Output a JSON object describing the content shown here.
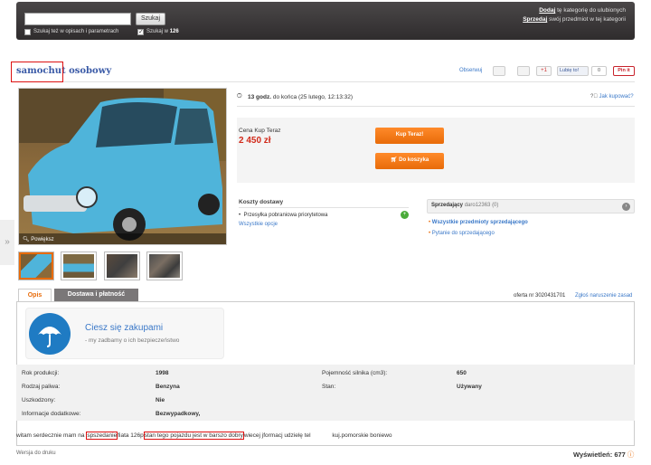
{
  "search": {
    "button_label": "Szukaj",
    "checkbox_desc_label": "Szukaj też w opisach i parametrach",
    "checkbox_cat_prefix": "Szukaj w",
    "checkbox_cat_value": "126"
  },
  "top_right": {
    "line1_link": "Dodaj",
    "line1_rest": "tę kategorię do ulubionych",
    "line2_link": "Sprzedaj",
    "line2_rest": "swój przedmiot w tej kategorii"
  },
  "title": "samochut osobowy",
  "actions": {
    "watch": "Obserwuj",
    "gplus": "+1",
    "fb_like": "Lubię to!",
    "fb_count": "0",
    "pinit": "Pin it"
  },
  "photo": {
    "zoom_label": "Powiększ"
  },
  "timer": {
    "bold": "13 godz.",
    "rest": "do końca (25 lutego, 12:13:32)"
  },
  "help_link": "Jak kupować?",
  "price": {
    "label": "Cena Kup Teraz",
    "value": "2 450 zł",
    "buy_now": "Kup Teraz!",
    "add_cart": "Do koszyka"
  },
  "shipping": {
    "title": "Koszty dostawy",
    "item": "Przesyłka pobraniowa priorytetowa",
    "all_options": "Wszystkie opcje"
  },
  "seller": {
    "label": "Sprzedający",
    "name": "daro12363 (0)",
    "all_items": "Wszystkie przedmioty sprzedającego",
    "ask": "Pytanie do sprzedającego"
  },
  "tabs": {
    "desc": "Opis",
    "delivery": "Dostawa i płatność"
  },
  "offer": {
    "number": "oferta nr 3020431701",
    "report": "Zgłoś naruszenie zasad"
  },
  "banner": {
    "title": "Ciesz się zakupami",
    "subtitle": "- my zadbamy o ich bezpieczeństwo"
  },
  "params": [
    {
      "label": "Rok produkcji:",
      "value": "1998",
      "label2": "Pojemność silnika (cm3):",
      "value2": "650"
    },
    {
      "label": "Rodzaj paliwa:",
      "value": "Benzyna",
      "label2": "Stan:",
      "value2": "Używany"
    },
    {
      "label": "Uszkodzony:",
      "value": "Nie",
      "label2": "",
      "value2": ""
    },
    {
      "label": "Informacje dodatkowe:",
      "value": "Bezwypadkowy,",
      "label2": "",
      "value2": ""
    }
  ],
  "description": {
    "part1": "witam serdecznie mam na",
    "part2": "spszedanie",
    "part3": "fiata 126p",
    "part4": "stan tego pojazdu jest w barszo dobry",
    "part5": "wiecej jformacj udzielę tel",
    "part6": "kuj.pomorskie boniewo"
  },
  "footer": {
    "print": "Wersja do druku",
    "views_label": "Wyświetleń:",
    "views_value": "677"
  },
  "colors": {
    "link": "#3a78c8",
    "orange": "#e86b09",
    "price_red": "#d12a1a",
    "highlight": "#dd1111"
  }
}
